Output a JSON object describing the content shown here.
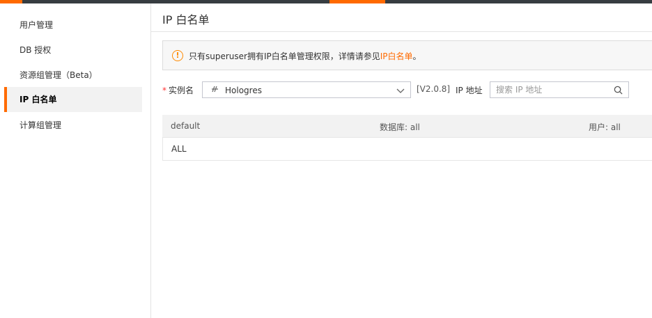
{
  "colors": {
    "accent": "#ff6a00",
    "topbar": "#373d41",
    "warning": "#ff8a00",
    "required": "#ff3333"
  },
  "sidebar": {
    "items": [
      {
        "label": "用户管理",
        "active": false
      },
      {
        "label": "DB 授权",
        "active": false
      },
      {
        "label": "资源组管理（Beta）",
        "active": false
      },
      {
        "label": "IP 白名单",
        "active": true
      },
      {
        "label": "计算组管理",
        "active": false
      }
    ]
  },
  "page": {
    "title": "IP 白名单"
  },
  "notice": {
    "icon": "info-circle-icon",
    "text_prefix": "只有superuser拥有IP白名单管理权限，详情请参见",
    "link": "IP白名单",
    "text_suffix": "。"
  },
  "filter": {
    "instance_label": "实例名",
    "required_mark": "*",
    "instance_icon": "hologres-logo-icon",
    "instance_value": "Hologres",
    "version": "[V2.0.8]",
    "ip_label": "IP 地址",
    "search_placeholder": "搜索 IP 地址"
  },
  "table": {
    "header": {
      "group": "default",
      "database": "数据库: all",
      "user": "用户: all"
    },
    "rows": [
      {
        "value": "ALL"
      }
    ]
  }
}
